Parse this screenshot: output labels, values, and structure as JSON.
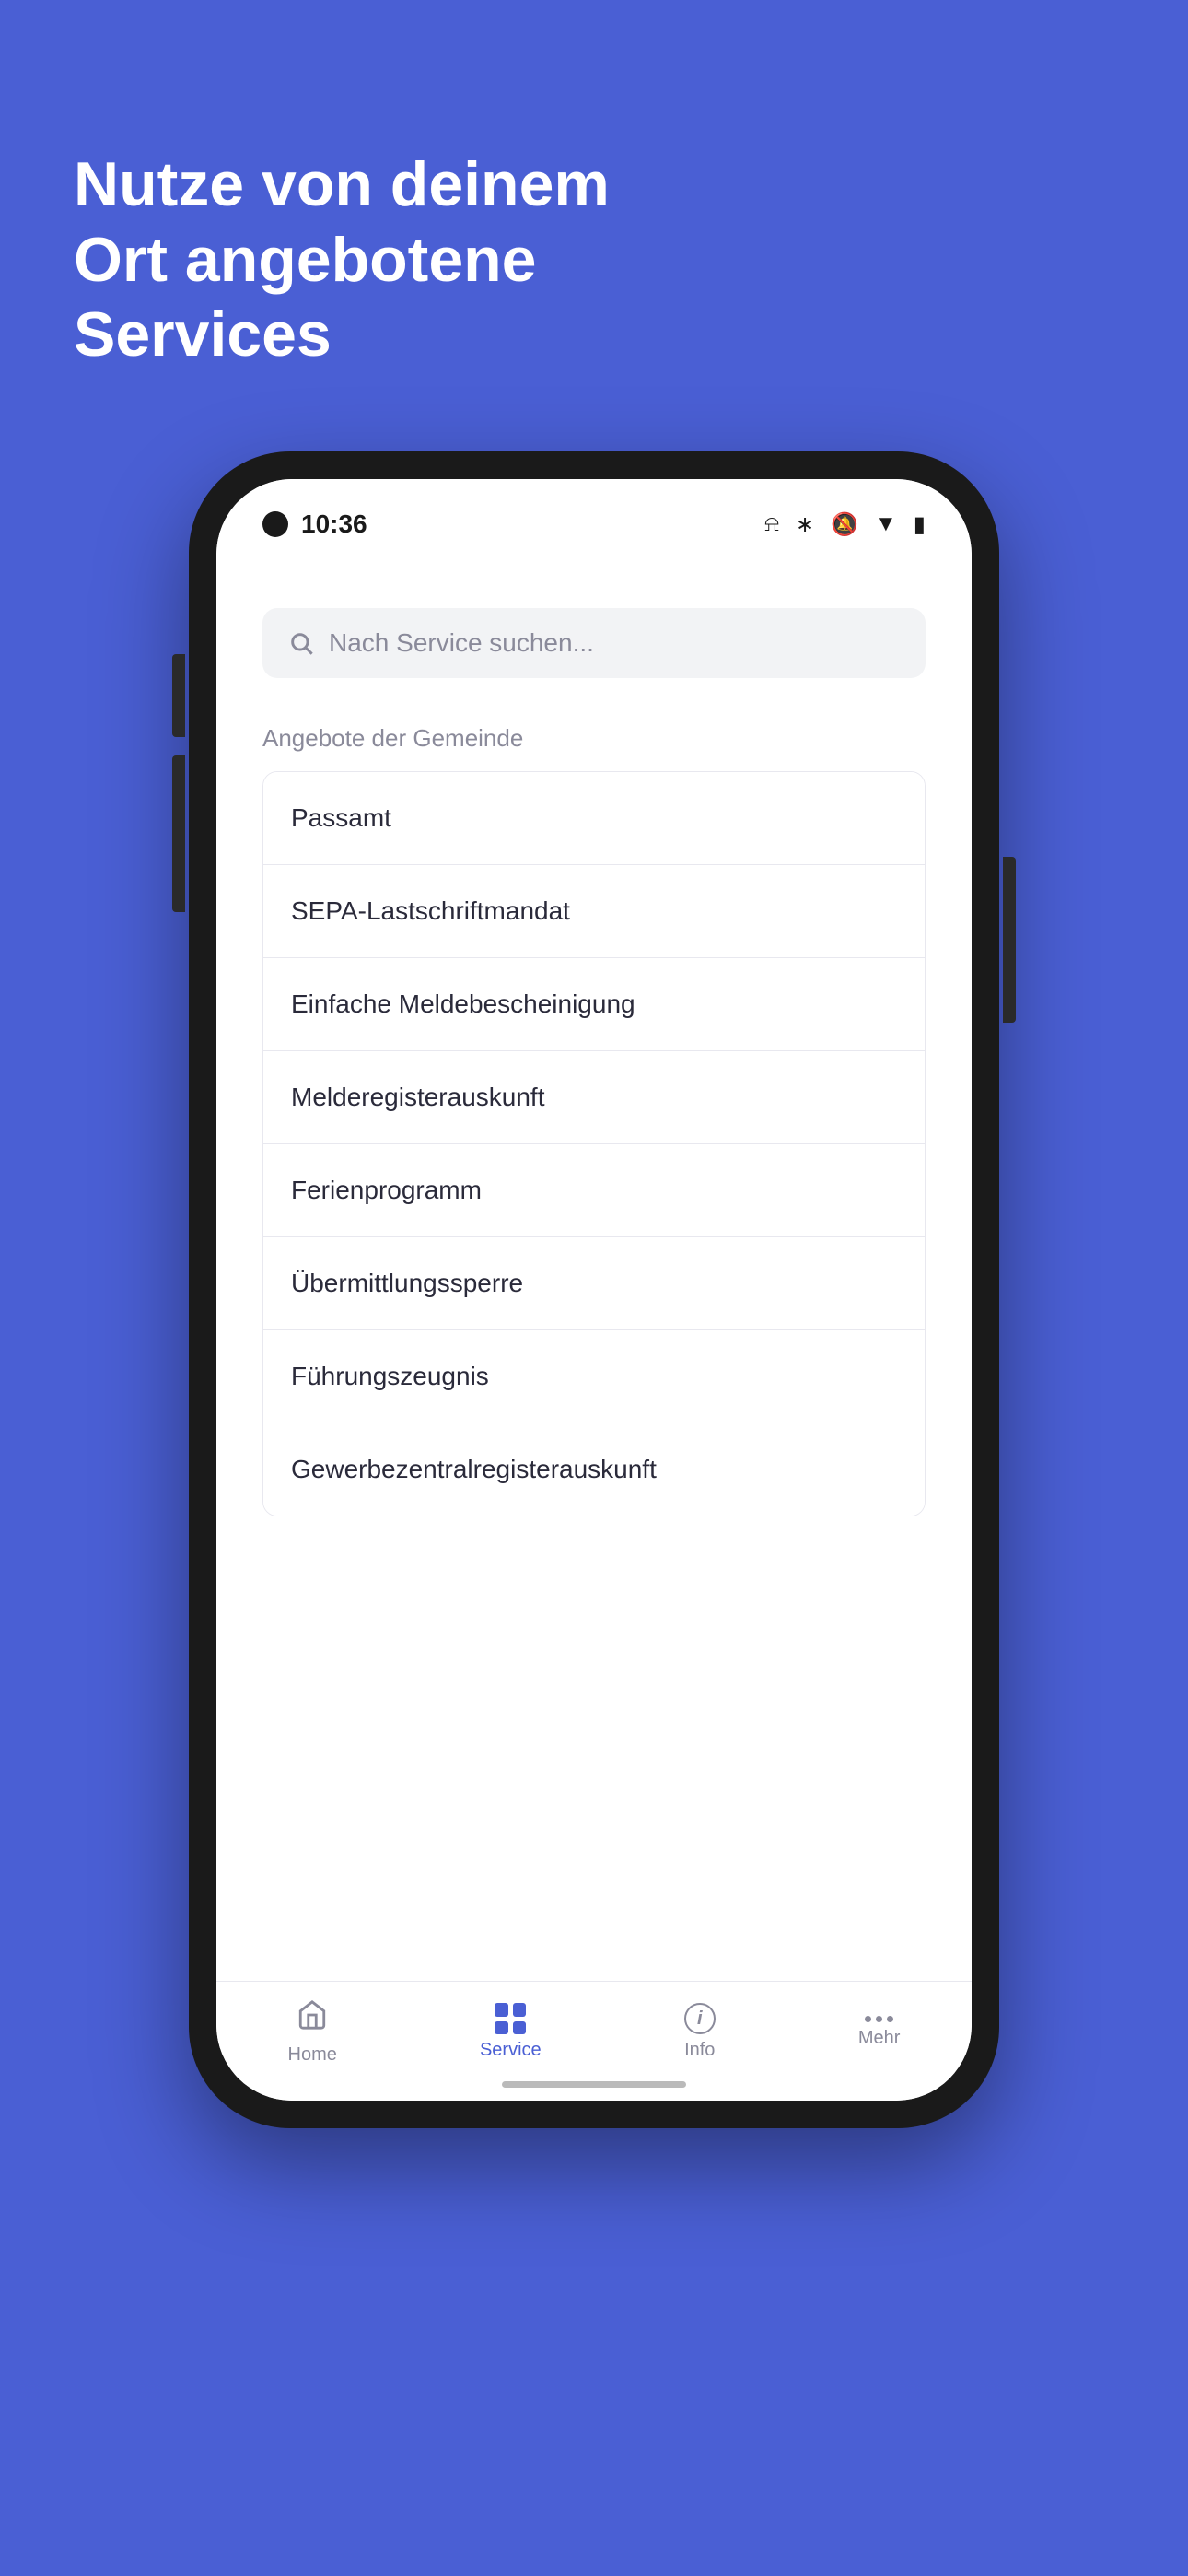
{
  "page": {
    "background_color": "#4a5fd4",
    "headline": "Nutze von deinem Ort angebotene Services"
  },
  "status_bar": {
    "time": "10:36",
    "icons": [
      "bluetooth",
      "muted-bell",
      "wifi",
      "battery"
    ]
  },
  "search": {
    "placeholder": "Nach Service suchen..."
  },
  "section": {
    "title": "Angebote der Gemeinde"
  },
  "services": [
    {
      "id": 1,
      "label": "Passamt"
    },
    {
      "id": 2,
      "label": "SEPA-Lastschriftmandat"
    },
    {
      "id": 3,
      "label": "Einfache Meldebescheinigung"
    },
    {
      "id": 4,
      "label": "Melderegisterauskunft"
    },
    {
      "id": 5,
      "label": "Ferienprogramm"
    },
    {
      "id": 6,
      "label": "Übermittlungssperre"
    },
    {
      "id": 7,
      "label": "Führungszeugnis"
    },
    {
      "id": 8,
      "label": "Gewerbezentralregisterauskunft"
    }
  ],
  "nav": {
    "items": [
      {
        "id": "home",
        "label": "Home",
        "active": false
      },
      {
        "id": "service",
        "label": "Service",
        "active": true
      },
      {
        "id": "info",
        "label": "Info",
        "active": false
      },
      {
        "id": "mehr",
        "label": "Mehr",
        "active": false
      }
    ]
  }
}
